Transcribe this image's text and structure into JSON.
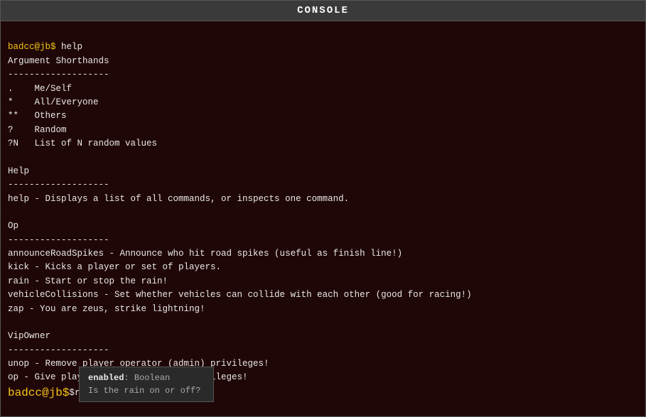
{
  "window": {
    "title": "CONSOLE"
  },
  "console": {
    "prompt": "badcc@jb$",
    "initial_command": "help",
    "input_command": "rain on",
    "content": [
      {
        "type": "prompt_line",
        "prompt": "badcc@jb$",
        "command": " help"
      },
      {
        "type": "text",
        "text": "Argument Shorthands"
      },
      {
        "type": "text",
        "text": "-------------------"
      },
      {
        "type": "text",
        "text": ".    Me/Self"
      },
      {
        "type": "text",
        "text": "*    All/Everyone"
      },
      {
        "type": "text",
        "text": "**   Others"
      },
      {
        "type": "text",
        "text": "?    Random"
      },
      {
        "type": "text",
        "text": "?N   List of N random values"
      },
      {
        "type": "blank"
      },
      {
        "type": "text",
        "text": "Help"
      },
      {
        "type": "text",
        "text": "-------------------"
      },
      {
        "type": "text",
        "text": "help - Displays a list of all commands, or inspects one command."
      },
      {
        "type": "blank"
      },
      {
        "type": "text",
        "text": "Op"
      },
      {
        "type": "text",
        "text": "-------------------"
      },
      {
        "type": "text",
        "text": "announceRoadSpikes - Announce who hit road spikes (useful as finish line!)"
      },
      {
        "type": "text",
        "text": "kick - Kicks a player or set of players."
      },
      {
        "type": "text",
        "text": "rain - Start or stop the rain!"
      },
      {
        "type": "text",
        "text": "vehicleCollisions - Set whether vehicles can collide with each other (good for racing!)"
      },
      {
        "type": "text",
        "text": "zap - You are zeus, strike lightning!"
      },
      {
        "type": "blank"
      },
      {
        "type": "text",
        "text": "VipOwner"
      },
      {
        "type": "text",
        "text": "-------------------"
      },
      {
        "type": "text",
        "text": "unop - Remove player operator (admin) privileges!"
      },
      {
        "type": "text",
        "text": "op - Give player operator (admin) privileges!"
      }
    ]
  },
  "tooltip": {
    "param_name": "enabled",
    "param_type": "Boolean",
    "description": "Is the rain on or off?"
  }
}
